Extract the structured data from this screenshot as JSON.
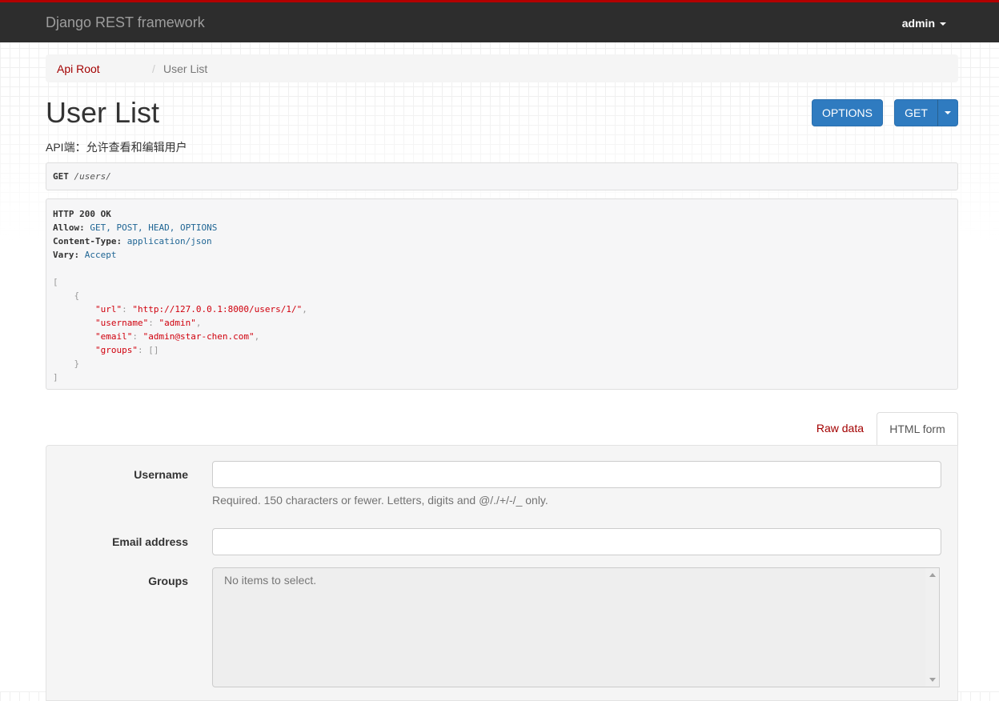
{
  "navbar": {
    "brand": "Django REST framework",
    "user": "admin"
  },
  "breadcrumb": {
    "items": [
      {
        "label": "Api Root"
      },
      {
        "label": "User List"
      }
    ],
    "separator": "/"
  },
  "page": {
    "title": "User List",
    "description": "API端：允许查看和编辑用户"
  },
  "buttons": {
    "options": "OPTIONS",
    "get": "GET"
  },
  "request": {
    "method": "GET",
    "path": "/users/"
  },
  "response": {
    "status": "HTTP 200 OK",
    "headers": [
      {
        "key": "Allow:",
        "value": "GET, POST, HEAD, OPTIONS"
      },
      {
        "key": "Content-Type:",
        "value": "application/json"
      },
      {
        "key": "Vary:",
        "value": "Accept"
      }
    ],
    "body": {
      "open_bracket": "[",
      "open_brace": "{",
      "fields": [
        {
          "key": "\"url\"",
          "value": "\"http://127.0.0.1:8000/users/1/\"",
          "sep": ","
        },
        {
          "key": "\"username\"",
          "value": "\"admin\"",
          "sep": ","
        },
        {
          "key": "\"email\"",
          "value": "\"admin@star-chen.com\"",
          "sep": ","
        },
        {
          "key": "\"groups\"",
          "value": "[]",
          "sep": ""
        }
      ],
      "close_brace": "}",
      "close_bracket": "]"
    }
  },
  "tabs": {
    "raw": "Raw data",
    "html": "HTML form"
  },
  "form": {
    "username_label": "Username",
    "username_value": "",
    "username_help": "Required. 150 characters or fewer. Letters, digits and @/./+/-/_ only.",
    "email_label": "Email address",
    "email_value": "",
    "groups_label": "Groups",
    "groups_empty": "No items to select."
  },
  "colors": {
    "brand_red": "#b20000",
    "navbar_bg": "#2d2d2d",
    "button_blue": "#2f7bc0",
    "link": "#a30000"
  }
}
